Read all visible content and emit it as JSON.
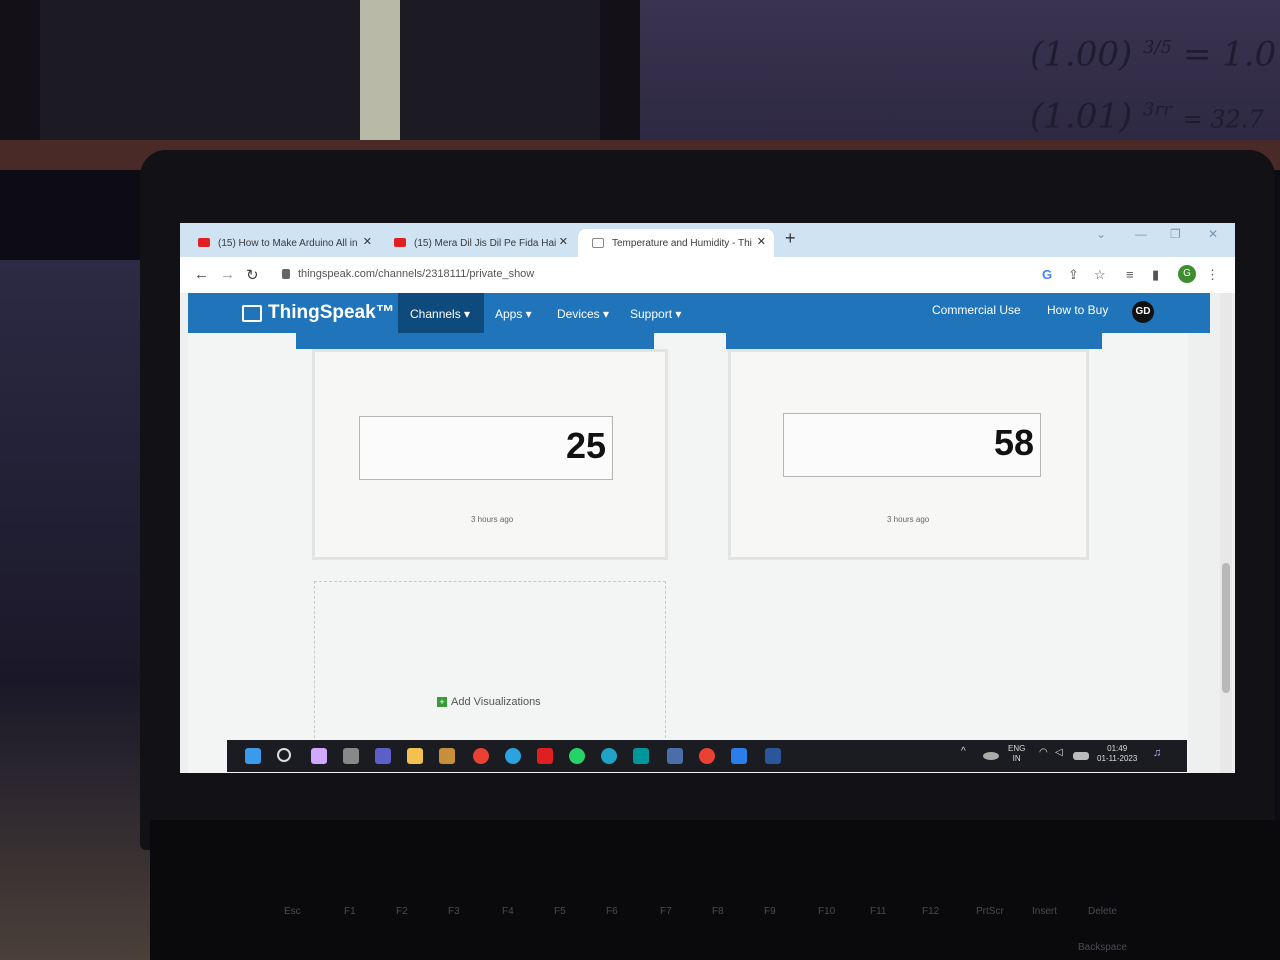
{
  "browser": {
    "tabs": [
      {
        "title": "(15) How to Make Arduino All in",
        "favicon": "youtube-icon"
      },
      {
        "title": "(15) Mera Dil Jis Dil Pe Fida Hai",
        "favicon": "youtube-icon"
      },
      {
        "title": "Temperature and Humidity - Thi",
        "favicon": "thingspeak-icon"
      }
    ],
    "new_tab": "+",
    "url": "thingspeak.com/channels/2318111/private_show",
    "profile_initial": "G"
  },
  "thingspeak": {
    "logo": "ThingSpeak™",
    "nav": [
      "Channels ▾",
      "Apps ▾",
      "Devices ▾",
      "Support ▾"
    ],
    "right_nav": [
      "Commercial Use",
      "How to Buy"
    ],
    "user_initials": "GD"
  },
  "widgets": [
    {
      "value": "25",
      "updated": "3 hours ago"
    },
    {
      "value": "58",
      "updated": "3 hours ago"
    }
  ],
  "add_visualizations": "Add Visualizations",
  "taskbar": {
    "lang": "ENG",
    "region": "IN",
    "time": "01:49",
    "date": "01-11-2023"
  },
  "keyboard": [
    "Esc",
    "F1",
    "F2",
    "F3",
    "F4",
    "F5",
    "F6",
    "F7",
    "F8",
    "F9",
    "F10",
    "F11",
    "F12",
    "PrtScr",
    "Insert",
    "Delete",
    "Backspace"
  ],
  "handwriting": {
    "line1": "(1.00)",
    "line2": "(1.01)",
    "exp1": "3/5",
    "exp2": "3rr",
    "res1": "= 1.0",
    "res2": "= 32.7"
  },
  "colors": {
    "thingspeak_blue": "#1f74ba",
    "channels_active": "#0f4a7d",
    "tab_bar": "#cfe3f3"
  }
}
